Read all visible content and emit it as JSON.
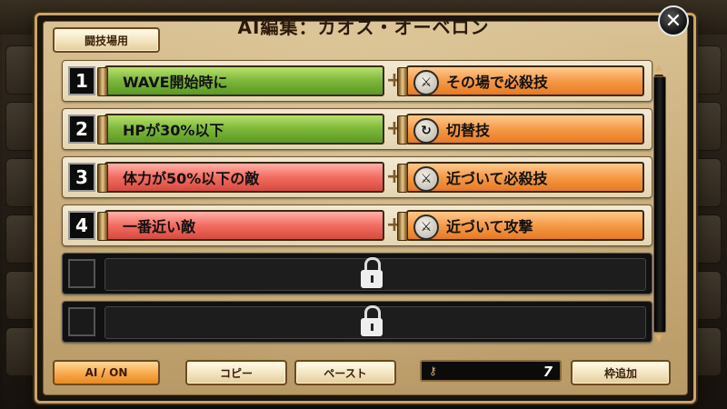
{
  "title": "AI編集：カオス・オーベロン",
  "mode_tab": "闘技場用",
  "close_label": "✕",
  "rows": [
    {
      "num": "1",
      "condition": "WAVE開始時に",
      "condition_color": "green",
      "action": "その場で必殺技",
      "action_icon": "sword-icon"
    },
    {
      "num": "2",
      "condition": "HPが30%以下",
      "condition_color": "green",
      "action": "切替技",
      "action_icon": "switch-icon"
    },
    {
      "num": "3",
      "condition": "体力が50%以下の敵",
      "condition_color": "red",
      "action": "近づいて必殺技",
      "action_icon": "sword-icon"
    },
    {
      "num": "4",
      "condition": "一番近い敵",
      "condition_color": "red",
      "action": "近づいて攻撃",
      "action_icon": "sword-icon"
    }
  ],
  "buttons": {
    "ai_on": "AI / ON",
    "copy": "コピー",
    "paste": "ペースト",
    "add_slot": "枠追加"
  },
  "key_count": "7"
}
